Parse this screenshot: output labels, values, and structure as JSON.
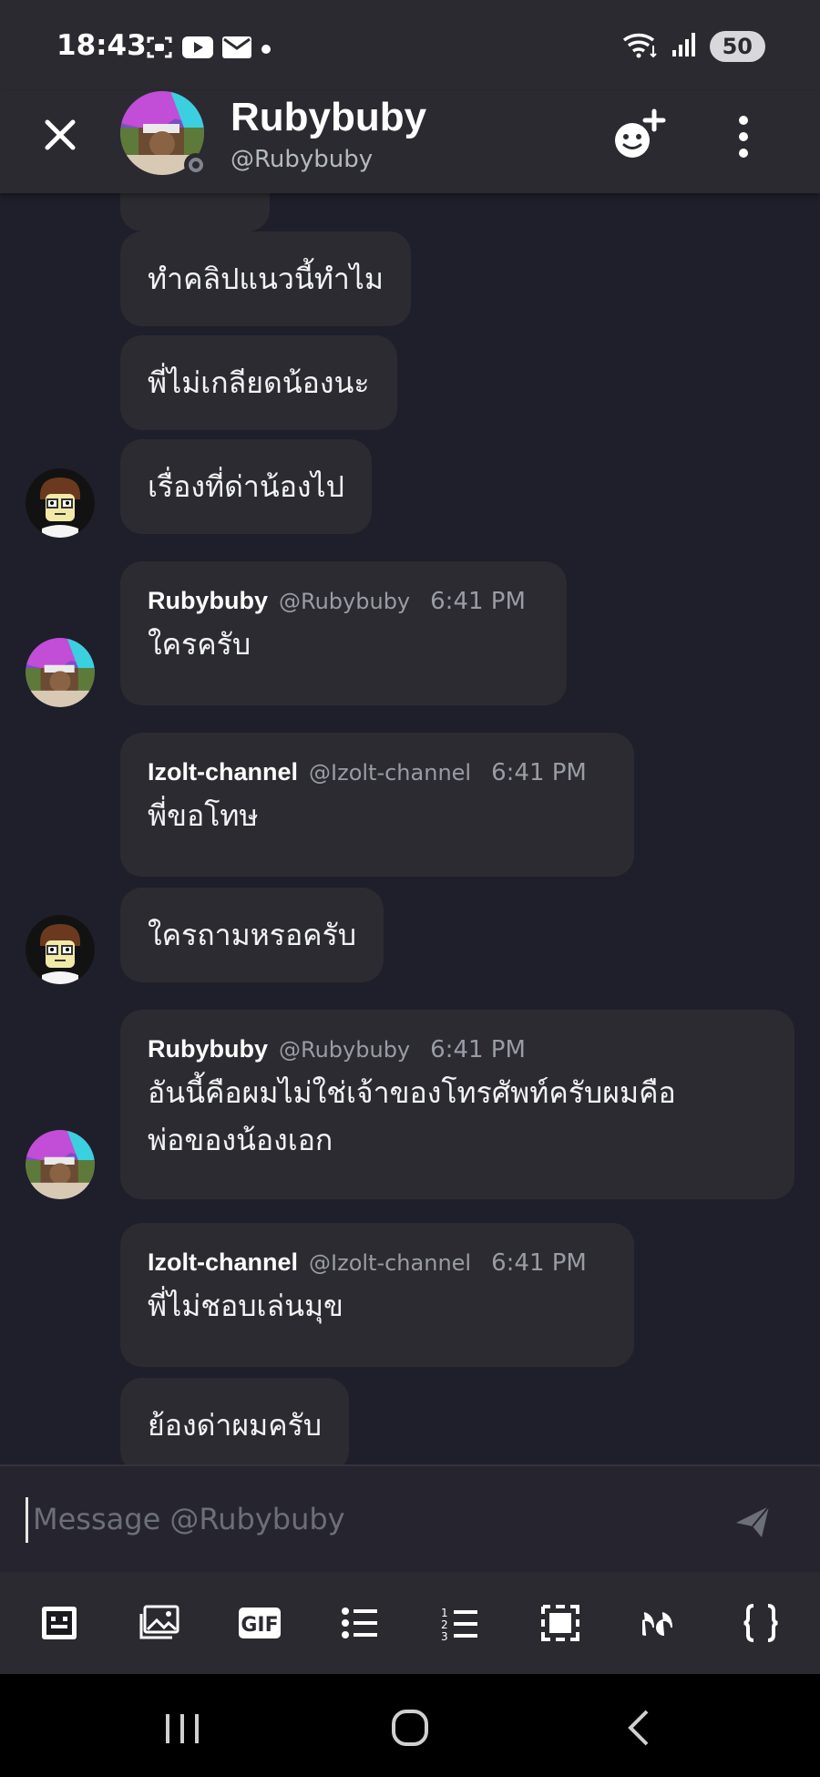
{
  "status_bar": {
    "time": "18:43",
    "battery": "50"
  },
  "header": {
    "name": "Rubybuby",
    "handle": "@Rubybuby"
  },
  "messages": [
    {
      "text": "ทำคลิปแนวนี้ทำไม"
    },
    {
      "text": "พี่ไม่เกลียดน้องนะ"
    },
    {
      "text": "เรื่องที่ด่าน้องไป"
    },
    {
      "author": "Rubybuby",
      "handle": "@Rubybuby",
      "time": "6:41 PM",
      "text": "ใครครับ"
    },
    {
      "author": "Izolt-channel",
      "handle": "@Izolt-channel",
      "time": "6:41 PM",
      "text": "พี่ขอโทษ"
    },
    {
      "text": "ใครถามหรอครับ"
    },
    {
      "author": "Rubybuby",
      "handle": "@Rubybuby",
      "time": "6:41 PM",
      "text_line1": "อันนี้คือผมไม่ใช่เจ้าของโทรศัพท์ครับผมคือ",
      "text_line2": "พ่อของน้องเอก"
    },
    {
      "author": "Izolt-channel",
      "handle": "@Izolt-channel",
      "time": "6:41 PM",
      "text": "พี่ไม่ชอบเล่นมุข"
    },
    {
      "text": "ย้องด่าผมครับ"
    }
  ],
  "composer": {
    "placeholder": "Message @Rubybuby"
  },
  "toolbar": {
    "items": [
      "emoji-icon",
      "image-icon",
      "gif-icon",
      "bullet-list-icon",
      "numbered-list-icon",
      "spoiler-icon",
      "quote-icon",
      "code-block-icon"
    ],
    "gif_label": "GIF"
  },
  "navigation": {
    "items": [
      "recent-apps-icon",
      "home-icon",
      "back-icon"
    ]
  }
}
